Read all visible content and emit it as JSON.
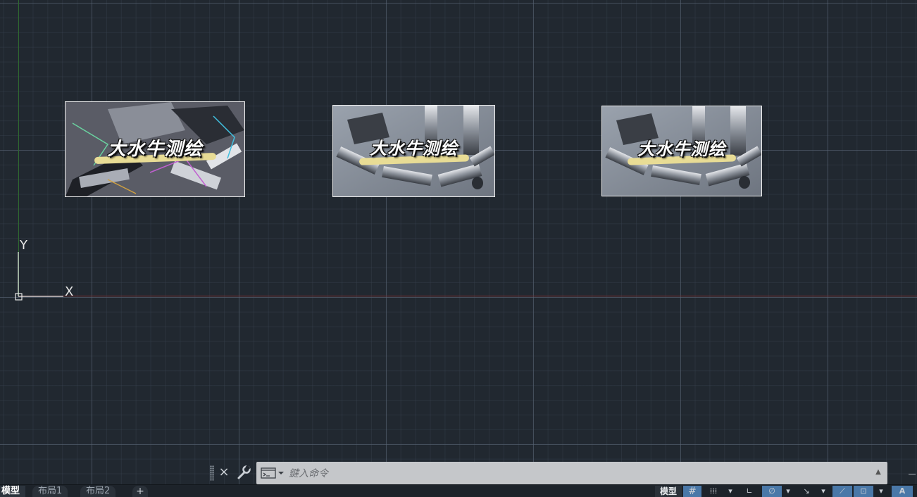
{
  "canvas": {
    "axis_x_label": "X",
    "axis_y_label": "Y",
    "colors": {
      "background": "#212830",
      "x_axis": "#7a2e30",
      "y_axis": "#2f6a2f"
    }
  },
  "images": [
    {
      "text": "大水牛测绘",
      "style": "posterized"
    },
    {
      "text": "大水牛测绘",
      "style": "normal"
    },
    {
      "text": "大水牛测绘",
      "style": "normal"
    }
  ],
  "command_line": {
    "placeholder": "鍵入命令",
    "close_glyph": "×",
    "history_glyph": "▲"
  },
  "tabs": [
    {
      "label": "模型",
      "active": true
    },
    {
      "label": "布局1",
      "active": false
    },
    {
      "label": "布局2",
      "active": false
    }
  ],
  "add_tab_glyph": "+",
  "status": {
    "model_label": "模型",
    "grid_glyph": "#",
    "snap_glyph": "⁞⁞⁞",
    "dropdown_glyph": "▾",
    "ortho_glyph": "∟",
    "polar_glyph": "∅",
    "osnap_glyph": "↘",
    "lineweight_glyph": "⟋",
    "select_glyph": "⊡",
    "anno_glyph": "A"
  }
}
